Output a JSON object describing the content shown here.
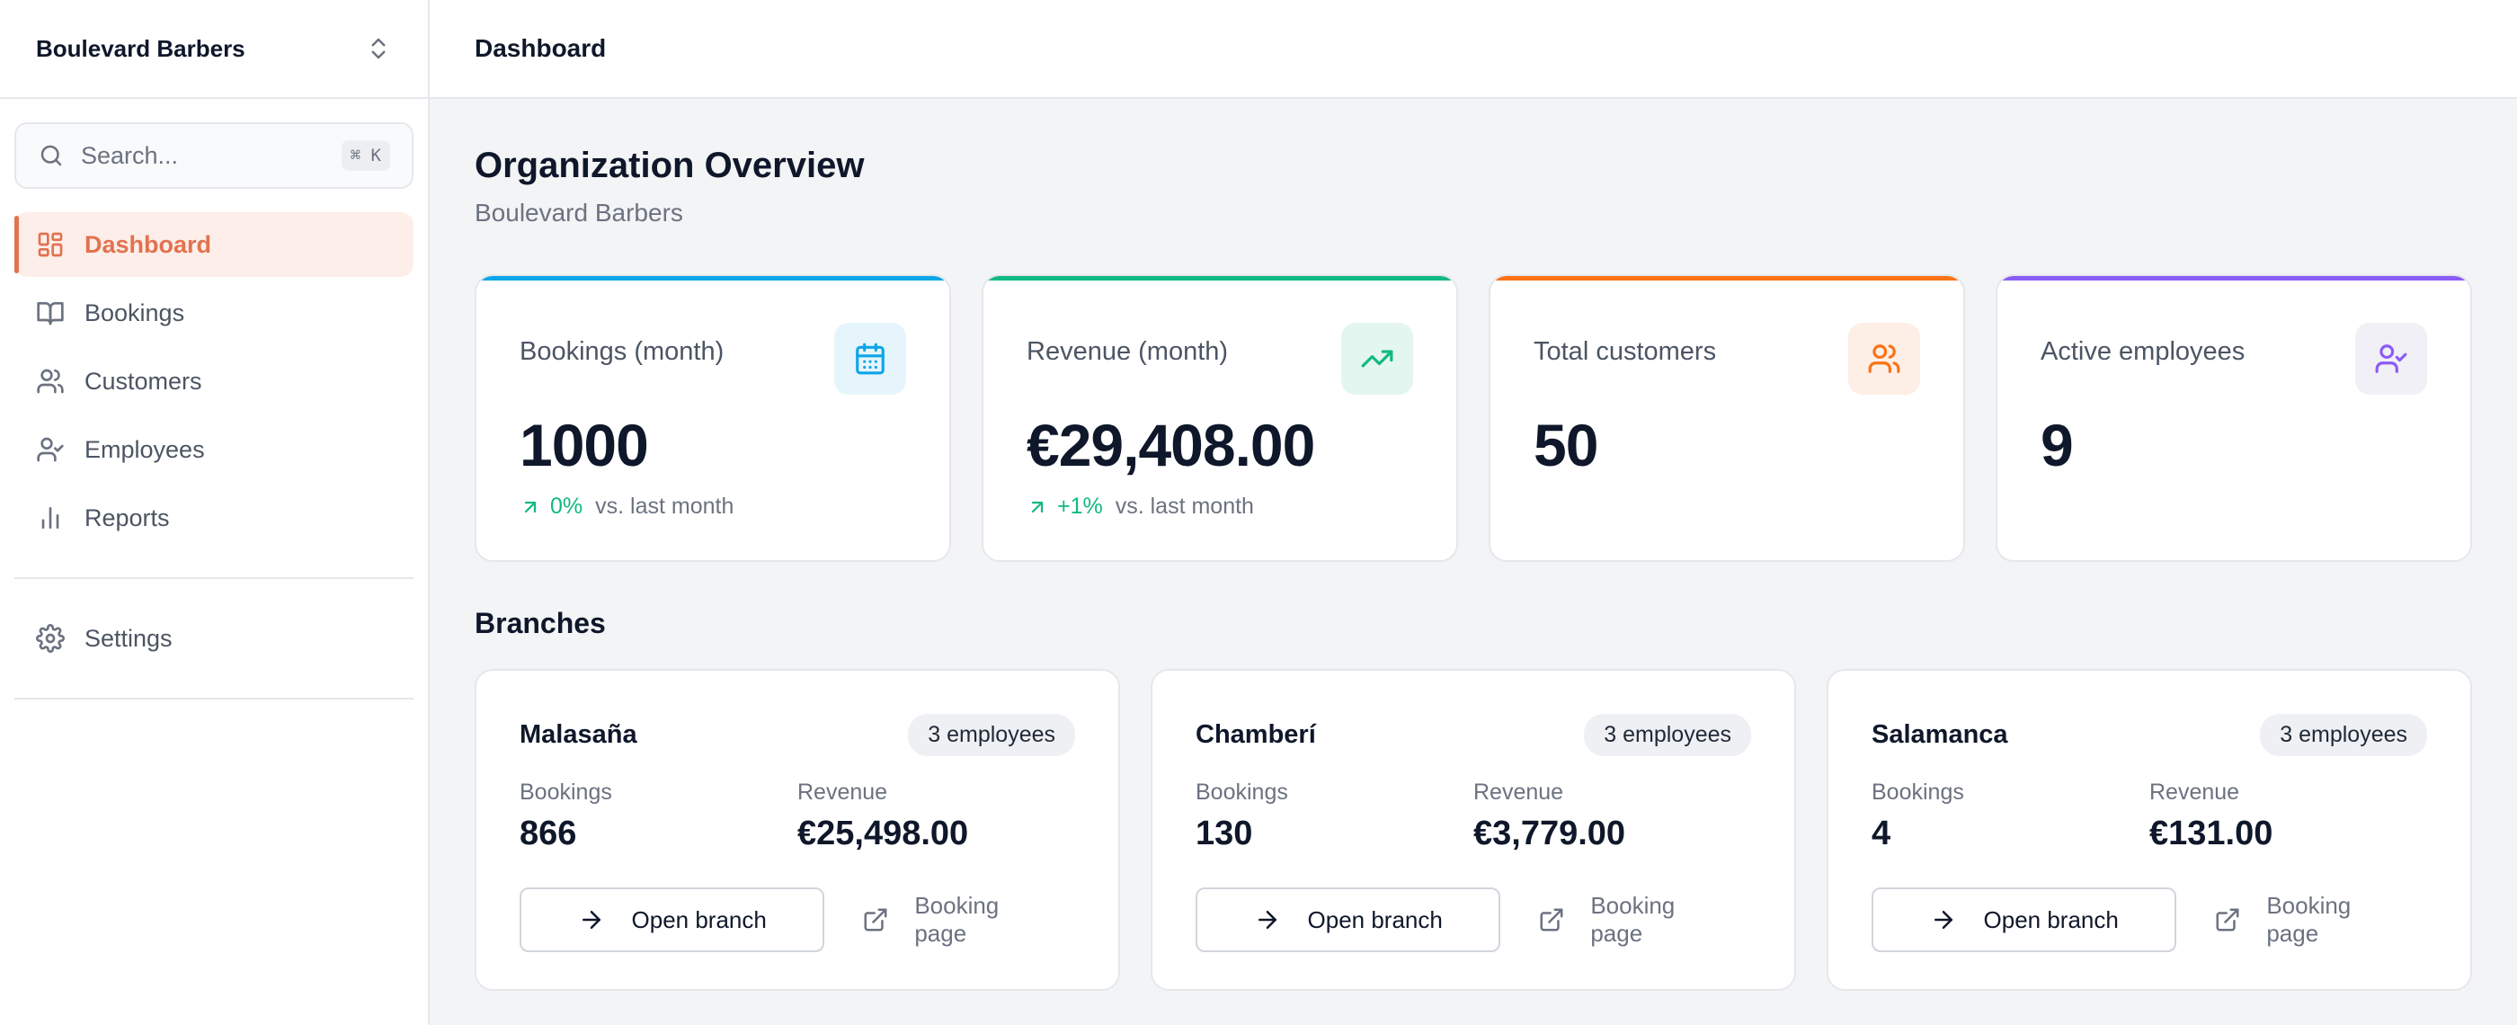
{
  "sidebar": {
    "org_name": "Boulevard Barbers",
    "search": {
      "placeholder": "Search...",
      "shortcut": "⌘ K"
    },
    "items": [
      {
        "label": "Dashboard",
        "icon": "layout-dashboard-icon",
        "active": true
      },
      {
        "label": "Bookings",
        "icon": "book-open-icon"
      },
      {
        "label": "Customers",
        "icon": "users-icon"
      },
      {
        "label": "Employees",
        "icon": "user-check-icon"
      },
      {
        "label": "Reports",
        "icon": "bar-chart-icon"
      }
    ],
    "settings_label": "Settings"
  },
  "header": {
    "title": "Dashboard"
  },
  "overview": {
    "title": "Organization Overview",
    "subtitle": "Boulevard Barbers"
  },
  "stats": [
    {
      "label": "Bookings (month)",
      "value": "1000",
      "trend_value": "0%",
      "trend_text": "vs. last month",
      "icon": "calendar-icon",
      "accent": "#0ea5e9",
      "icon_bg": "#e6f5fb",
      "icon_color": "#0ea5e9"
    },
    {
      "label": "Revenue (month)",
      "value": "€29,408.00",
      "trend_value": "+1%",
      "trend_text": "vs. last month",
      "icon": "trending-up-icon",
      "accent": "#10b981",
      "icon_bg": "#e3f6ef",
      "icon_color": "#10b981"
    },
    {
      "label": "Total customers",
      "value": "50",
      "icon": "users-icon",
      "accent": "#f97316",
      "icon_bg": "#fdeee6",
      "icon_color": "#f97316"
    },
    {
      "label": "Active employees",
      "value": "9",
      "icon": "user-check-icon",
      "accent": "#8b5cf6",
      "icon_bg": "#f1f0f6",
      "icon_color": "#8b5cf6"
    }
  ],
  "branches_section": {
    "title": "Branches"
  },
  "branches": [
    {
      "name": "Malasaña",
      "badge": "3 employees",
      "bookings_label": "Bookings",
      "bookings": "866",
      "revenue_label": "Revenue",
      "revenue": "€25,498.00",
      "open_label": "Open branch",
      "booking_page_label": "Booking page"
    },
    {
      "name": "Chamberí",
      "badge": "3 employees",
      "bookings_label": "Bookings",
      "bookings": "130",
      "revenue_label": "Revenue",
      "revenue": "€3,779.00",
      "open_label": "Open branch",
      "booking_page_label": "Booking page"
    },
    {
      "name": "Salamanca",
      "badge": "3 employees",
      "bookings_label": "Bookings",
      "bookings": "4",
      "revenue_label": "Revenue",
      "revenue": "€131.00",
      "open_label": "Open branch",
      "booking_page_label": "Booking page"
    }
  ]
}
